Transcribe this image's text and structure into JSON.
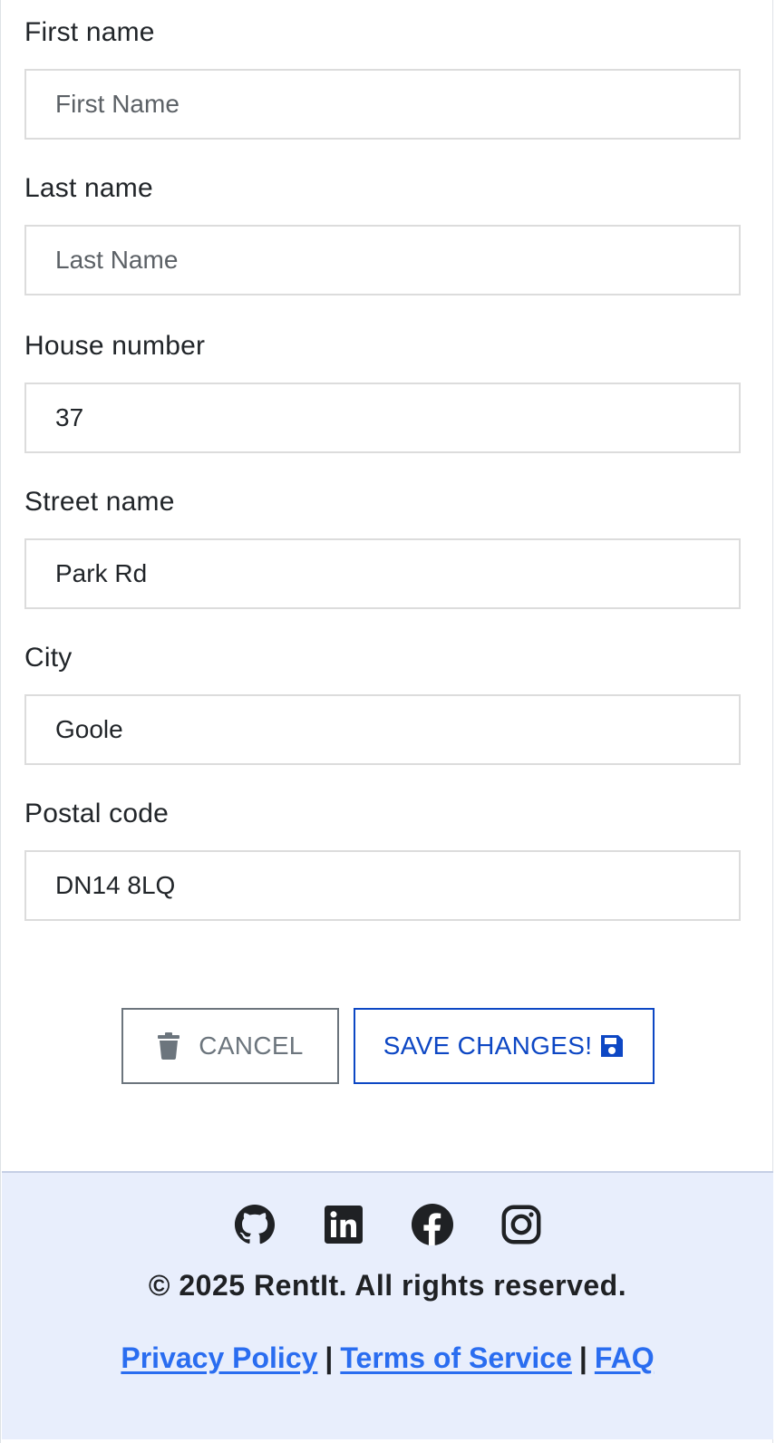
{
  "form": {
    "first_name": {
      "label": "First name",
      "placeholder": "First Name",
      "value": ""
    },
    "last_name": {
      "label": "Last name",
      "placeholder": "Last Name",
      "value": ""
    },
    "house_number": {
      "label": "House number",
      "placeholder": "",
      "value": "37"
    },
    "street_name": {
      "label": "Street name",
      "placeholder": "",
      "value": "Park Rd"
    },
    "city": {
      "label": "City",
      "placeholder": "",
      "value": "Goole"
    },
    "postal_code": {
      "label": "Postal code",
      "placeholder": "",
      "value": "DN14 8LQ"
    }
  },
  "actions": {
    "cancel_label": "CANCEL",
    "save_label": "SAVE CHANGES!"
  },
  "footer": {
    "socials": [
      "github-icon",
      "linkedin-icon",
      "facebook-icon",
      "instagram-icon"
    ],
    "copyright": "© 2025 RentIt. All rights reserved.",
    "links": {
      "privacy": "Privacy Policy",
      "terms": "Terms of Service",
      "faq": "FAQ",
      "separator": "|"
    }
  },
  "colors": {
    "primary": "#0d47c4",
    "secondary": "#6c757d",
    "link": "#2a6df0",
    "footer_bg": "#e8eefc"
  }
}
